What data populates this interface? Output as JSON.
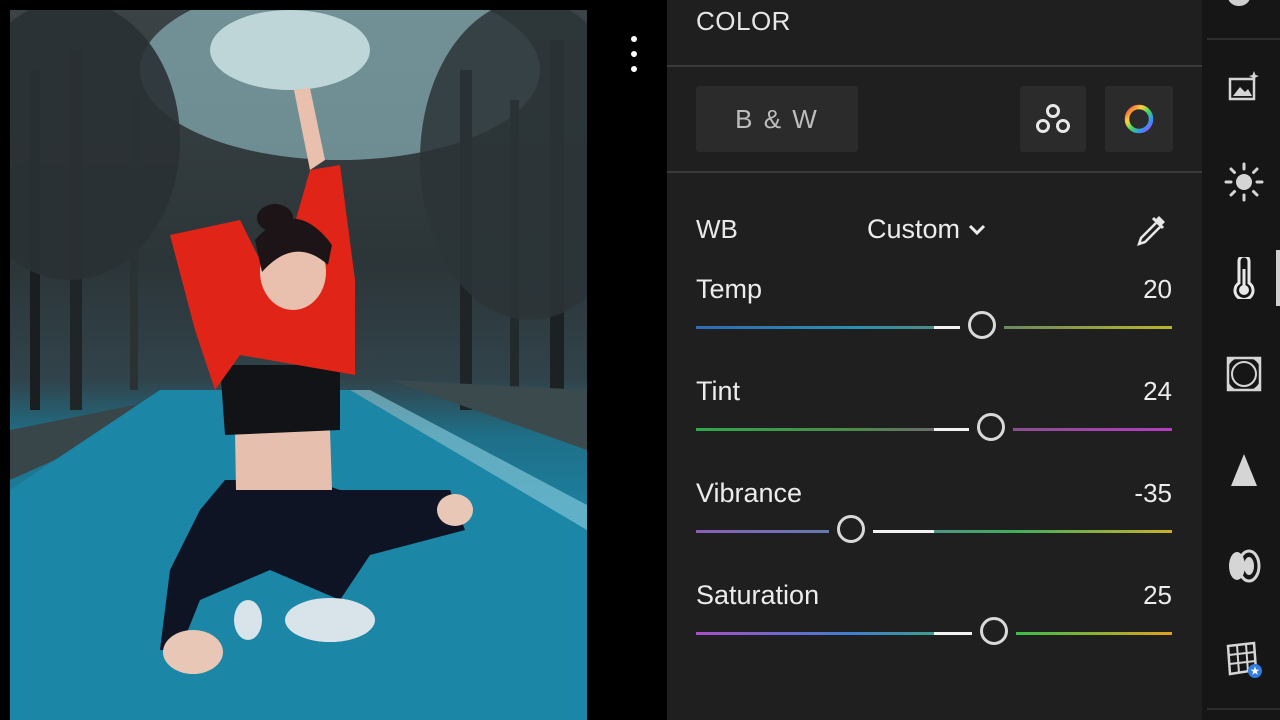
{
  "photo": {
    "more_icon": "more-vertical-icon"
  },
  "panel": {
    "title": "COLOR",
    "bw_label": "B & W",
    "mix_icon": "color-mixer-icon",
    "grading_icon": "color-grading-icon",
    "wb": {
      "label": "WB",
      "value": "Custom",
      "dropdown_icon": "chevron-down-icon",
      "eyedropper_icon": "eyedropper-icon"
    },
    "sliders": [
      {
        "name": "Temp",
        "value": "20",
        "level": 20,
        "min": -100,
        "max": 100
      },
      {
        "name": "Tint",
        "value": "24",
        "level": 24,
        "min": -100,
        "max": 100
      },
      {
        "name": "Vibrance",
        "value": "-35",
        "level": -35,
        "min": -100,
        "max": 100
      },
      {
        "name": "Saturation",
        "value": "25",
        "level": 25,
        "min": -100,
        "max": 100
      }
    ]
  },
  "rail": {
    "icons": [
      "auto-enhance-icon",
      "light-icon",
      "color-icon",
      "effects-icon",
      "detail-icon",
      "optics-icon",
      "geometry-icon"
    ],
    "active": "color-icon"
  },
  "colors": {
    "panel_bg": "#1f1f1f",
    "rail_bg": "#161616",
    "button_bg": "#2b2b2b"
  }
}
